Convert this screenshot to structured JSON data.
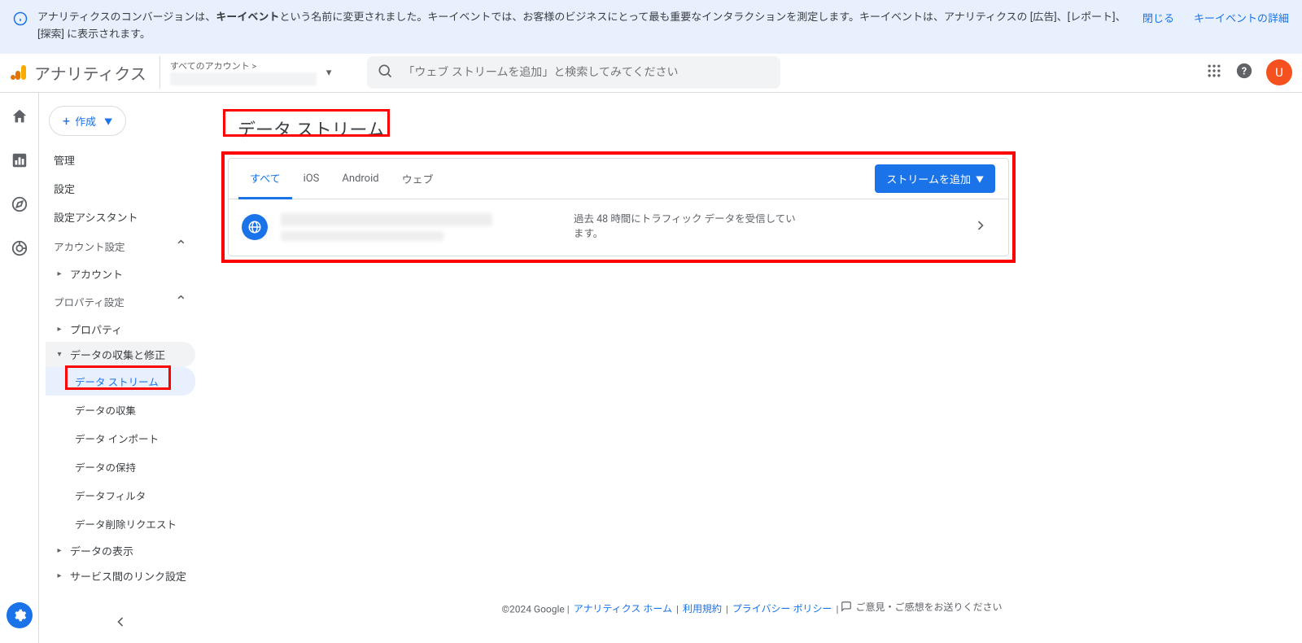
{
  "banner": {
    "text_before": "アナリティクスのコンバージョンは、",
    "text_bold": "キーイベント",
    "text_after": "という名前に変更されました。キーイベントでは、お客様のビジネスにとって最も重要なインタラクションを測定します。キーイベントは、アナリティクスの [広告]、[レポート]、[探索] に表示されます。",
    "close": "閉じる",
    "details": "キーイベントの詳細"
  },
  "header": {
    "product": "アナリティクス",
    "account_label": "すべてのアカウント >",
    "search_placeholder": "「ウェブ ストリームを追加」と検索してみてください",
    "avatar_letter": "U"
  },
  "sidebar": {
    "create": "作成",
    "admin": "管理",
    "settings": "設定",
    "setup_assistant": "設定アシスタント",
    "account_settings": "アカウント設定",
    "account": "アカウント",
    "property_settings": "プロパティ設定",
    "property": "プロパティ",
    "data_collection_mod": "データの収集と修正",
    "data_streams": "データ ストリーム",
    "data_collection": "データの収集",
    "data_import": "データ インポート",
    "data_retention": "データの保持",
    "data_filter": "データフィルタ",
    "data_deletion": "データ削除リクエスト",
    "data_display": "データの表示",
    "product_links": "サービス間のリンク設定"
  },
  "main": {
    "title": "データ ストリーム",
    "tabs": {
      "all": "すべて",
      "ios": "iOS",
      "android": "Android",
      "web": "ウェブ"
    },
    "add_stream": "ストリームを追加",
    "stream_status": "過去 48 時間にトラフィック データを受信しています。"
  },
  "footer": {
    "copyright": "©2024 Google",
    "home": "アナリティクス ホーム",
    "terms": "利用規約",
    "privacy": "プライバシー ポリシー",
    "feedback": "ご意見・ご感想をお送りください"
  }
}
